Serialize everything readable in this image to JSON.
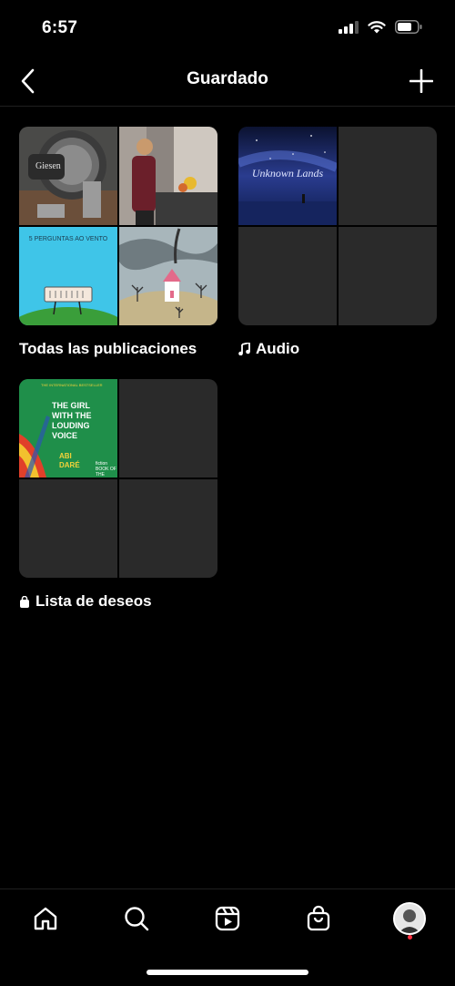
{
  "status": {
    "time": "6:57"
  },
  "header": {
    "title": "Guardado"
  },
  "collections": [
    {
      "label": "Todas las publicaciones",
      "thumbs": {
        "machine_text": "Giesen",
        "poster_text": "5 PERGUNTAS AO VENTO"
      }
    },
    {
      "label": "Audio",
      "icon": "music-note-icon",
      "thumbs": {
        "cover_text": "Unknown Lands"
      }
    },
    {
      "label": "Lista de deseos",
      "icon": "shopping-bag-icon",
      "thumbs": {
        "book_top": "THE INTERNATIONAL BESTSELLER",
        "book_title_1": "THE GIRL",
        "book_title_2": "WITH THE",
        "book_title_3": "LOUDING",
        "book_title_4": "VOICE",
        "book_author_1": "ABI",
        "book_author_2": "DARÉ",
        "book_badge_1": "fiction",
        "book_badge_2": "BOOK OF THE MONTH"
      }
    }
  ],
  "bottom_nav": [
    "home-icon",
    "search-icon",
    "reels-icon",
    "shop-icon",
    "profile-avatar"
  ],
  "colors": {
    "background": "#000000",
    "empty_cell": "#2a2a2a",
    "notification": "#ff3040"
  }
}
